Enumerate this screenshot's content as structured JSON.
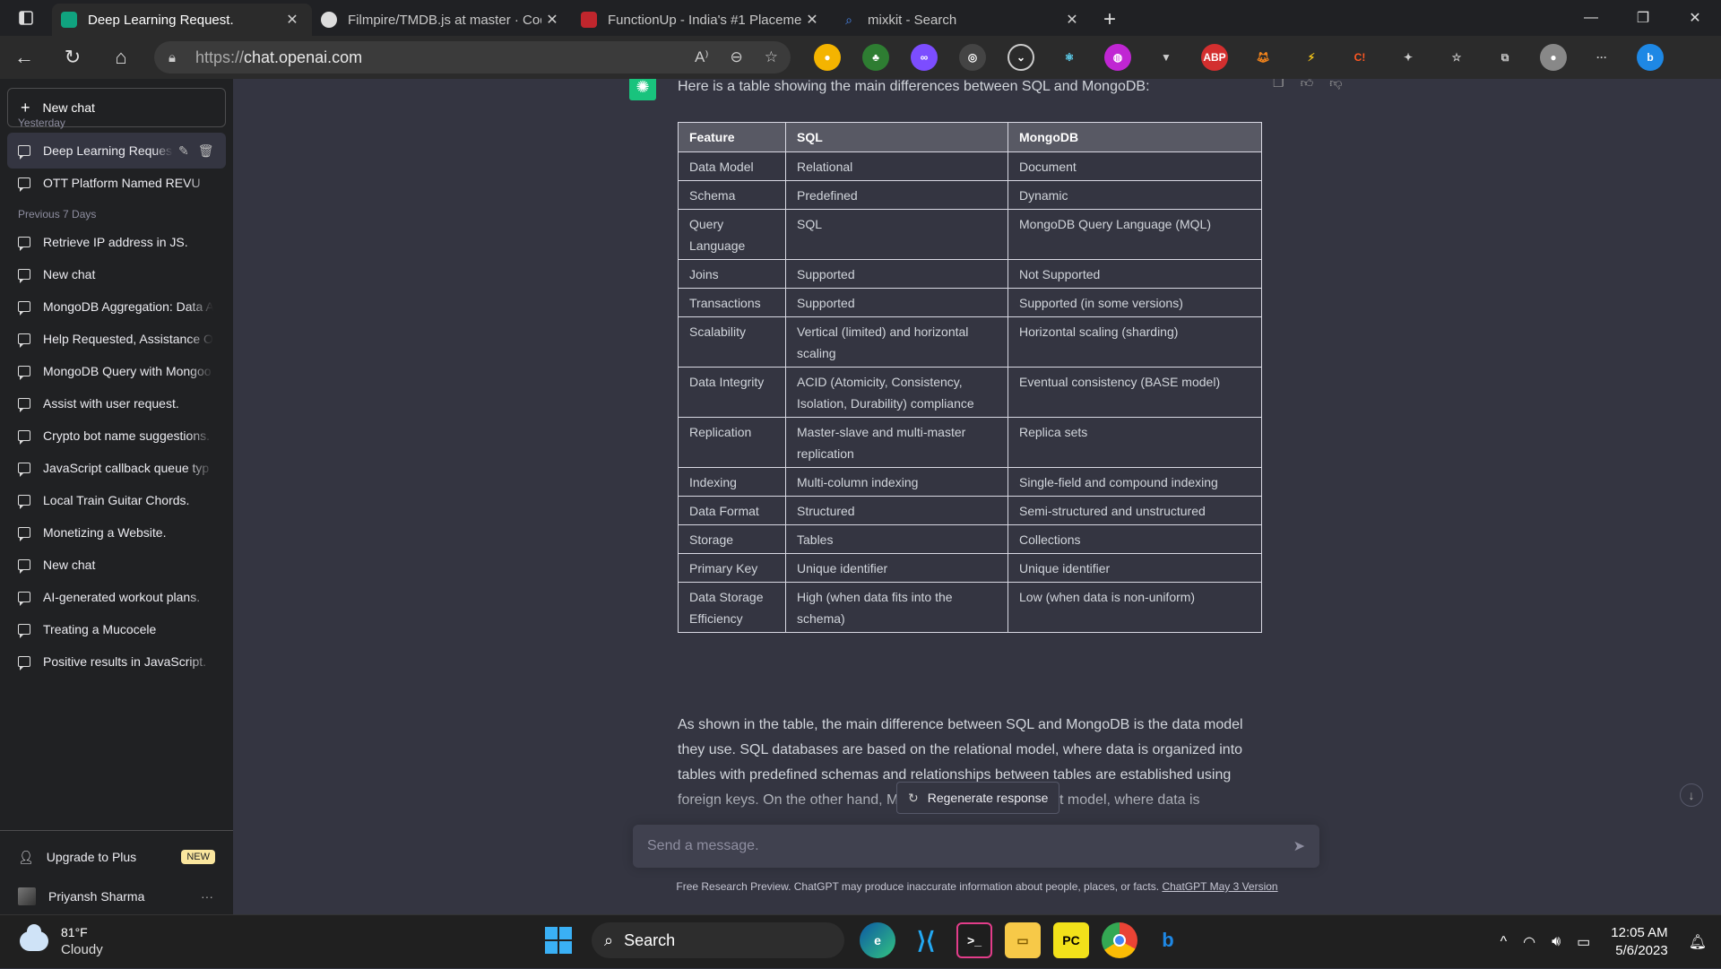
{
  "browser": {
    "tabs": [
      {
        "title": "Deep Learning Request.",
        "favicon_color": "#10a37f",
        "active": true
      },
      {
        "title": "Filmpire/TMDB.js at master · Cod",
        "favicon_color": "#ffffff",
        "active": false
      },
      {
        "title": "FunctionUp - India's #1 Placemen",
        "favicon_color": "#c0262d",
        "active": false
      },
      {
        "title": "mixkit - Search",
        "favicon_color": "#2b2b2b",
        "active": false
      }
    ],
    "url_proto": "https://",
    "url_host": "chat.openai.com"
  },
  "sidebar": {
    "new_chat": "New chat",
    "section_yesterday": "Yesterday",
    "section_prev7": "Previous 7 Days",
    "items_yesterday": [
      {
        "label": "Deep Learning Reques"
      },
      {
        "label": "OTT Platform Named REVU"
      }
    ],
    "items_prev7": [
      {
        "label": "Retrieve IP address in JS."
      },
      {
        "label": "New chat"
      },
      {
        "label": "MongoDB Aggregation: Data A"
      },
      {
        "label": "Help Requested, Assistance O"
      },
      {
        "label": "MongoDB Query with Mongoo"
      },
      {
        "label": "Assist with user request."
      },
      {
        "label": "Crypto bot name suggestions."
      },
      {
        "label": "JavaScript callback queue typ"
      },
      {
        "label": "Local Train Guitar Chords."
      },
      {
        "label": "Monetizing a Website."
      },
      {
        "label": "New chat"
      },
      {
        "label": "AI-generated workout plans."
      },
      {
        "label": "Treating a Mucocele"
      },
      {
        "label": "Positive results in JavaScript."
      }
    ],
    "upgrade_label": "Upgrade to Plus",
    "upgrade_badge": "NEW",
    "user_name": "Priyansh Sharma",
    "user_more": "···"
  },
  "chat": {
    "intro": "Here is a table showing the main differences between SQL and MongoDB:",
    "table": {
      "headers": [
        "Feature",
        "SQL",
        "MongoDB"
      ],
      "rows": [
        [
          "Data Model",
          "Relational",
          "Document"
        ],
        [
          "Schema",
          "Predefined",
          "Dynamic"
        ],
        [
          "Query Language",
          "SQL",
          "MongoDB Query Language (MQL)"
        ],
        [
          "Joins",
          "Supported",
          "Not Supported"
        ],
        [
          "Transactions",
          "Supported",
          "Supported (in some versions)"
        ],
        [
          "Scalability",
          "Vertical (limited) and horizontal scaling",
          "Horizontal scaling (sharding)"
        ],
        [
          "Data Integrity",
          "ACID (Atomicity, Consistency, Isolation, Durability) compliance",
          "Eventual consistency (BASE model)"
        ],
        [
          "Replication",
          "Master-slave and multi-master replication",
          "Replica sets"
        ],
        [
          "Indexing",
          "Multi-column indexing",
          "Single-field and compound indexing"
        ],
        [
          "Data Format",
          "Structured",
          "Semi-structured and unstructured"
        ],
        [
          "Storage",
          "Tables",
          "Collections"
        ],
        [
          "Primary Key",
          "Unique identifier",
          "Unique identifier"
        ],
        [
          "Data Storage Efficiency",
          "High (when data fits into the schema)",
          "Low (when data is non-uniform)"
        ]
      ]
    },
    "paragraph": "As shown in the table, the main difference between SQL and MongoDB is the data model they use. SQL databases are based on the relational model, where data is organized into tables with predefined schemas and relationships between tables are established using foreign keys. On the other hand, MongoDB uses a document model, where data is",
    "regenerate": "Regenerate response",
    "input_placeholder": "Send a message.",
    "footnote": "Free Research Preview. ChatGPT may produce inaccurate information about people, places, or facts.",
    "footnote_link": "ChatGPT May 3 Version"
  },
  "taskbar": {
    "temp": "81°F",
    "condition": "Cloudy",
    "search": "Search",
    "time": "12:05 AM",
    "date": "5/6/2023"
  }
}
